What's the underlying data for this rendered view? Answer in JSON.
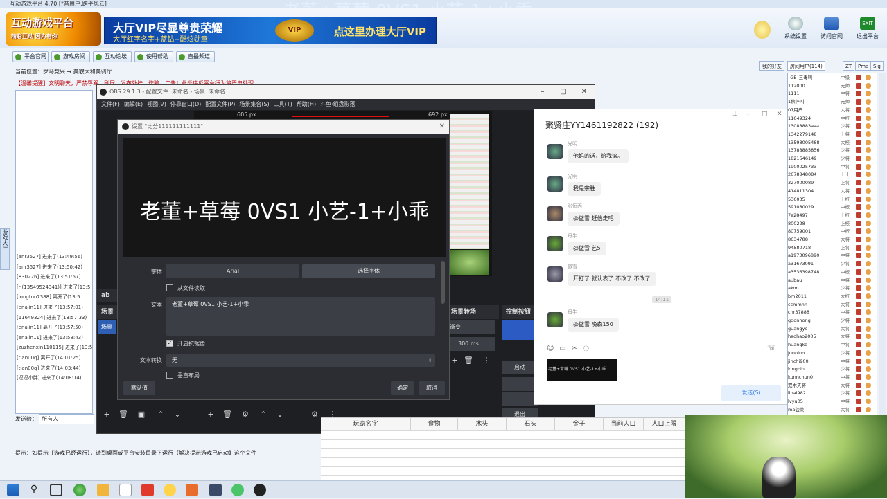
{
  "app": {
    "title": "互动游戏平台 4.70 [*音用户:跨平风云]",
    "overlay_text": "老董+草莓 0VS1 小艺-1+小乖"
  },
  "banner": {
    "logo_text": "互动游戏平台",
    "logo_sub": "精彩互动 因为有你",
    "vip_line1": "大厅VIP尽显尊贵荣耀",
    "vip_line2": "大厅红字名字+蓝钻+酷炫勋章",
    "vip_badge": "VIP",
    "vip_cta": "点这里办理大厅VIP",
    "buttons": [
      {
        "label": "系统设置",
        "icon": "gear-icon"
      },
      {
        "label": "访问官网",
        "icon": "home-icon"
      },
      {
        "label": "退出平台",
        "icon": "exit-icon"
      }
    ],
    "exit_text": "EXIT"
  },
  "nav": {
    "tabs": [
      "平台官网",
      "游戏房间",
      "互动论坛",
      "使用帮助",
      "直播频道"
    ]
  },
  "location": "当前位置：罗马竞兴 → 美貌大和美骑厅",
  "notice": "【温馨提醒】文明聊天，严禁辱骂，刷屏，发布外挂，诈骗，广告！此类违反平台行为将严肃处理",
  "side_strip": "游戏大厅",
  "log": [
    "[anr3527] 进来了(13:49:56)",
    "[anr3527] 进来了(13:50:42)",
    "[830226] 进来了(13:51:57)",
    "[rl(13549524341)] 进来了(13:5",
    "[longton7388] 离开了(13:5",
    "[enalin11] 进来了(13:57:01)",
    "[11649324] 进来了(13:57:33)",
    "[enalin11] 离开了(13:57:50)",
    "[enalin11] 进来了(13:58:43)",
    "[zuzhenxin110115] 进来了(13:5",
    "[tian00q] 离开了(14:01:25)",
    "[tian00q] 进来了(14:03:44)",
    "[逗逗小胖] 进来了(14:08:14)"
  ],
  "input": {
    "label": "发送给：",
    "value": "所有人"
  },
  "hint": "提示：如提示【游戏已经运行】，请到桌面或平台安装目录下运行【解决提示游戏已启动】这个文件",
  "obs": {
    "title": "OBS 29.1.3 - 配置文件: 未命名 - 场景: 未命名",
    "menu": [
      "文件(F)",
      "编辑(E)",
      "视图(V)",
      "停靠窗口(D)",
      "配置文件(P)",
      "场景集合(S)",
      "工具(T)",
      "帮助(H)",
      "斗鱼·组盘影落"
    ],
    "px_left": "605 px",
    "px_right": "692 px",
    "docks": {
      "scenes": "场景",
      "transitions": "场景转场",
      "controls": "控制按钮"
    },
    "scene_item": "场景",
    "trans_value": "渐变",
    "duration": "300 ms",
    "start_label": "启动",
    "exit_label": "退出"
  },
  "dialog": {
    "title": "设置 \"比分111111111111\"",
    "preview_text": "老董+草莓 0VS1 小艺-1+小乖",
    "font_label": "字体",
    "font_name": "Arial",
    "select_font": "选择字体",
    "from_file": "从文件读取",
    "text_label": "文本",
    "text_value": "老董+草莓 0VS1 小艺-1+小乖",
    "antialias": "开启抗锯齿",
    "transform_label": "文本转换",
    "transform_value": "无",
    "vertical": "垂直布局",
    "defaults": "默认值",
    "ok": "确定",
    "cancel": "取消"
  },
  "chat": {
    "title": "聚贤庄YY1461192822 (192)",
    "messages": [
      {
        "name": "光明",
        "text": "他妈的话，给我滚。"
      },
      {
        "name": "光明",
        "text": "我是宗胜"
      },
      {
        "name": "张恒丙",
        "text": "@傲雪 赶他走吧"
      },
      {
        "name": "母牛",
        "text": "@傲雪 艺5"
      },
      {
        "name": "傲雪",
        "text": "开打了 就认表了 不改了 不改了"
      },
      {
        "name": "母牛",
        "text": "@傲雪 晚森150"
      }
    ],
    "timestamp": "14:11",
    "picture_text": "老董+草莓 0VS1 小艺-1+小乖",
    "send": "发送(S)"
  },
  "right_tabs": [
    "我的好友",
    "房间用户(114)",
    "ZT",
    "Pma",
    "Sig"
  ],
  "users": [
    {
      "n": "_GE_三毒叫",
      "r": "中级"
    },
    {
      "n": "112000",
      "r": "元帅"
    },
    {
      "n": "1111",
      "r": "中将"
    },
    {
      "n": "1伙伴叫",
      "r": "元帅"
    },
    {
      "n": "07用户",
      "r": "大将"
    },
    {
      "n": "11649324",
      "r": "中校"
    },
    {
      "n": "13088883aaa",
      "r": "少将"
    },
    {
      "n": "1342279148",
      "r": "上将"
    },
    {
      "n": "13598005488",
      "r": "大校"
    },
    {
      "n": "13788885856",
      "r": "少将"
    },
    {
      "n": "1821646149",
      "r": "少将"
    },
    {
      "n": "1900025733",
      "r": "中将"
    },
    {
      "n": "2678848084",
      "r": "上士"
    },
    {
      "n": "327000089",
      "r": "上将"
    },
    {
      "n": "414811304",
      "r": "大将"
    },
    {
      "n": "536035",
      "r": "上校"
    },
    {
      "n": "591080029",
      "r": "中校"
    },
    {
      "n": "7e28497",
      "r": "上校"
    },
    {
      "n": "800228",
      "r": "上校"
    },
    {
      "n": "80759001",
      "r": "中校"
    },
    {
      "n": "8634788",
      "r": "大将"
    },
    {
      "n": "94580718",
      "r": "上将"
    },
    {
      "n": "a1973096890",
      "r": "中将"
    },
    {
      "n": "a31673091",
      "r": "少将"
    },
    {
      "n": "a3536398748",
      "r": "中校"
    },
    {
      "n": "aubau",
      "r": "中将"
    },
    {
      "n": "akoo",
      "r": "少将"
    },
    {
      "n": "bm2011",
      "r": "大校"
    },
    {
      "n": "ccmmhn",
      "r": "大将"
    },
    {
      "n": "cnr37888",
      "r": "中将"
    },
    {
      "n": "gdonhong",
      "r": "少将"
    },
    {
      "n": "guangye",
      "r": "大将"
    },
    {
      "n": "haohao2005",
      "r": "大将"
    },
    {
      "n": "huangke",
      "r": "中将"
    },
    {
      "n": "junnluo",
      "r": "少将"
    },
    {
      "n": "jinchi900",
      "r": "中将"
    },
    {
      "n": "kingbin",
      "r": "少将"
    },
    {
      "n": "kunnchun0",
      "r": "中将"
    },
    {
      "n": "双木天将",
      "r": "大将"
    },
    {
      "n": "linai982",
      "r": "少将"
    },
    {
      "n": "lvyu05",
      "r": "中将"
    },
    {
      "n": "ma菠菜",
      "r": "大将"
    }
  ],
  "sheet": {
    "headers": [
      "玩家名字",
      "食物",
      "木头",
      "石头",
      "金子",
      "当前人口",
      "人口上限"
    ]
  }
}
